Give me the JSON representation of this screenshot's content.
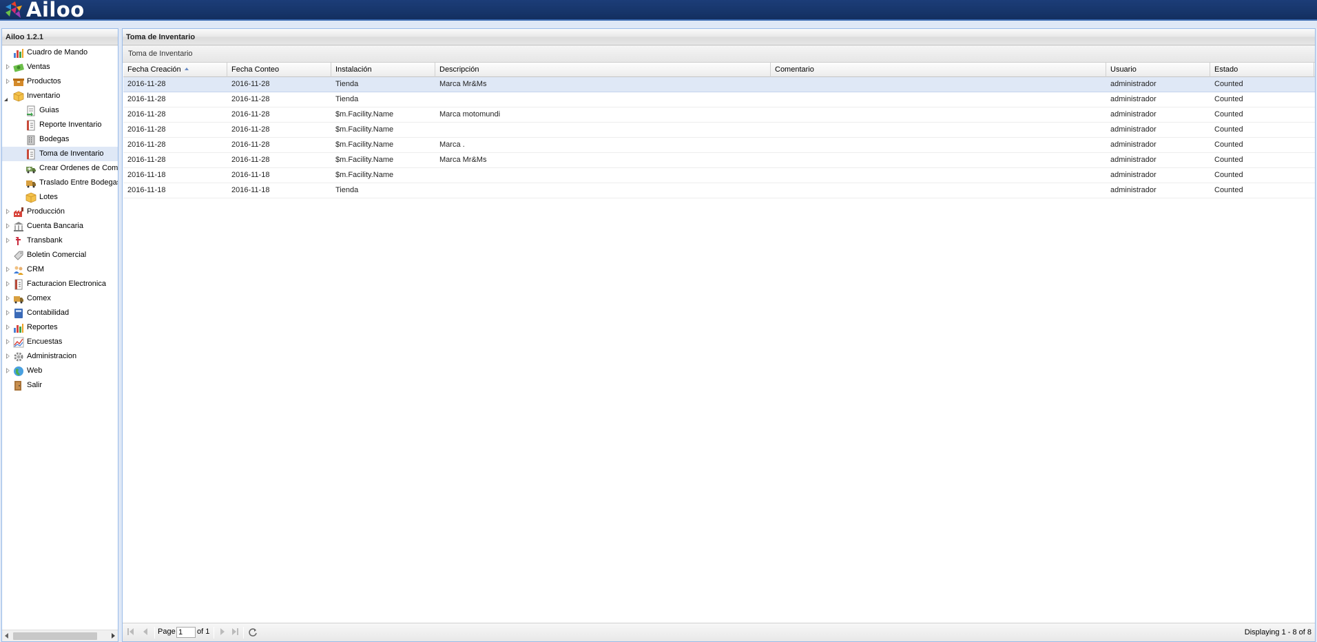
{
  "app": {
    "logo_text": "Ailoo",
    "version_title": "Ailoo 1.2.1"
  },
  "nav": [
    {
      "label": "Cuadro de Mando",
      "icon": "chart-bar-icon",
      "expandable": false,
      "level": 0
    },
    {
      "label": "Ventas",
      "icon": "money-icon",
      "expandable": true,
      "level": 0
    },
    {
      "label": "Productos",
      "icon": "box-icon",
      "expandable": true,
      "level": 0
    },
    {
      "label": "Inventario",
      "icon": "package-icon",
      "expandable": true,
      "expanded": true,
      "level": 0
    },
    {
      "label": "Guias",
      "icon": "document-arrow-icon",
      "expandable": false,
      "level": 1
    },
    {
      "label": "Reporte Inventario",
      "icon": "report-icon",
      "expandable": false,
      "level": 1
    },
    {
      "label": "Bodegas",
      "icon": "building-icon",
      "expandable": false,
      "level": 1
    },
    {
      "label": "Toma de Inventario",
      "icon": "report-icon",
      "expandable": false,
      "level": 1,
      "selected": true
    },
    {
      "label": "Crear Ordenes de Com",
      "icon": "truck-add-icon",
      "expandable": false,
      "level": 1
    },
    {
      "label": "Traslado Entre Bodegas",
      "icon": "truck-icon",
      "expandable": false,
      "level": 1
    },
    {
      "label": "Lotes",
      "icon": "package-icon",
      "expandable": false,
      "level": 1
    },
    {
      "label": "Producción",
      "icon": "factory-icon",
      "expandable": true,
      "level": 0
    },
    {
      "label": "Cuenta Bancaria",
      "icon": "bank-icon",
      "expandable": true,
      "level": 0
    },
    {
      "label": "Transbank",
      "icon": "transbank-icon",
      "expandable": true,
      "level": 0
    },
    {
      "label": "Boletin Comercial",
      "icon": "tag-icon",
      "expandable": false,
      "level": 0
    },
    {
      "label": "CRM",
      "icon": "users-icon",
      "expandable": true,
      "level": 0
    },
    {
      "label": "Facturacion Electronica",
      "icon": "invoice-icon",
      "expandable": true,
      "level": 0
    },
    {
      "label": "Comex",
      "icon": "truck-icon",
      "expandable": true,
      "level": 0
    },
    {
      "label": "Contabilidad",
      "icon": "ledger-icon",
      "expandable": true,
      "level": 0
    },
    {
      "label": "Reportes",
      "icon": "chart-bar-icon",
      "expandable": true,
      "level": 0
    },
    {
      "label": "Encuestas",
      "icon": "chart-line-icon",
      "expandable": true,
      "level": 0
    },
    {
      "label": "Administracion",
      "icon": "gear-icon",
      "expandable": true,
      "level": 0
    },
    {
      "label": "Web",
      "icon": "globe-icon",
      "expandable": true,
      "level": 0
    },
    {
      "label": "Salir",
      "icon": "door-exit-icon",
      "expandable": false,
      "level": 0
    }
  ],
  "center": {
    "panel_title": "Toma de Inventario",
    "grid_title": "Toma de Inventario",
    "columns": [
      "Fecha Creación",
      "Fecha Conteo",
      "Instalación",
      "Descripción",
      "Comentario",
      "Usuario",
      "Estado"
    ],
    "sorted_column": "Fecha Creación",
    "rows": [
      [
        "2016-11-28",
        "2016-11-28",
        "Tienda",
        "Marca Mr&Ms",
        "",
        "administrador",
        "Counted"
      ],
      [
        "2016-11-28",
        "2016-11-28",
        "Tienda",
        "",
        "",
        "administrador",
        "Counted"
      ],
      [
        "2016-11-28",
        "2016-11-28",
        "$m.Facility.Name",
        "Marca motomundi",
        "",
        "administrador",
        "Counted"
      ],
      [
        "2016-11-28",
        "2016-11-28",
        "$m.Facility.Name",
        "",
        "",
        "administrador",
        "Counted"
      ],
      [
        "2016-11-28",
        "2016-11-28",
        "$m.Facility.Name",
        "Marca .",
        "",
        "administrador",
        "Counted"
      ],
      [
        "2016-11-28",
        "2016-11-28",
        "$m.Facility.Name",
        "Marca Mr&Ms",
        "",
        "administrador",
        "Counted"
      ],
      [
        "2016-11-18",
        "2016-11-18",
        "$m.Facility.Name",
        "",
        "",
        "administrador",
        "Counted"
      ],
      [
        "2016-11-18",
        "2016-11-18",
        "Tienda",
        "",
        "",
        "administrador",
        "Counted"
      ]
    ],
    "selected_row": 0
  },
  "pager": {
    "page_label": "Page",
    "page_value": "1",
    "of_label": "of 1",
    "displaying": "Displaying 1 - 8 of 8"
  }
}
